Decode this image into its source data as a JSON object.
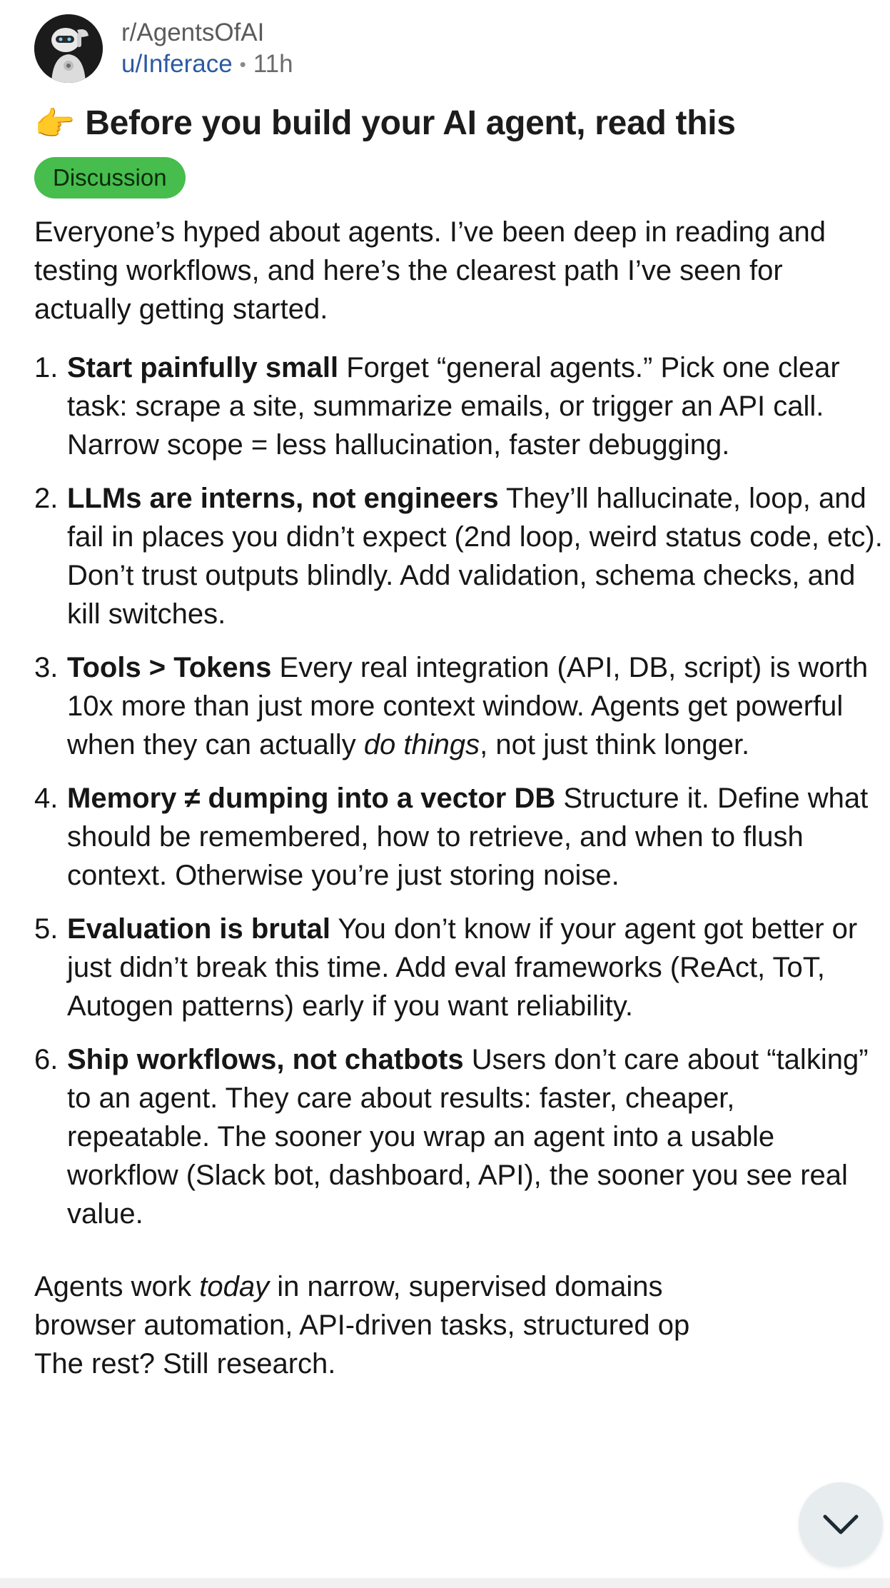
{
  "post": {
    "subreddit": "r/AgentsOfAI",
    "author": "u/Inferace",
    "separator": "•",
    "age": "11h",
    "title_emoji": "👉",
    "title": "Before you build your AI agent, read this",
    "flair": "Discussion",
    "intro": "Everyone’s hyped about agents. I’ve been deep in reading and testing workflows, and here’s the clearest path I’ve seen for actually getting started.",
    "points": [
      {
        "number": "1.",
        "heading": "Start painfully small",
        "text": " Forget “general agents.” Pick one clear task: scrape a site, summarize emails, or trigger an API call. Narrow scope = less hallucination, faster debugging."
      },
      {
        "number": "2.",
        "heading": "LLMs are interns, not engineers",
        "text": " They’ll hallucinate, loop, and fail in places you didn’t expect (2nd loop, weird status code, etc). Don’t trust outputs blindly. Add validation, schema checks, and kill switches."
      },
      {
        "number": "3.",
        "heading": "Tools > Tokens",
        "text_before": " Every real integration (API, DB, script) is worth 10x more than just more context window. Agents get powerful when they can actually ",
        "text_italic": "do things",
        "text_after": ", not just think longer."
      },
      {
        "number": "4.",
        "heading": "Memory ≠ dumping into a vector DB",
        "text": " Structure it. Define what should be remembered, how to retrieve, and when to flush context. Otherwise you’re just storing noise."
      },
      {
        "number": "5.",
        "heading": "Evaluation is brutal",
        "text": " You don’t know if your agent got better or just didn’t break this time. Add eval frameworks (ReAct, ToT, Autogen patterns) early if you want reliability."
      },
      {
        "number": "6.",
        "heading": "Ship workflows, not chatbots",
        "text": " Users don’t care about “talking” to an agent. They care about results: faster, cheaper, repeatable. The sooner you wrap an agent into a usable workflow (Slack bot, dashboard, API), the sooner you see real value."
      }
    ],
    "outro": {
      "line1_before": "Agents work ",
      "line1_italic": "today",
      "line1_after": " in narrow, supervised domains",
      "line2": "browser automation, API-driven tasks, structured op",
      "line3": "The rest? Still research."
    }
  },
  "icons": {
    "avatar": "robot-avatar-icon",
    "scroll": "chevron-down-icon"
  },
  "colors": {
    "flair_bg": "#46bd4d",
    "author": "#2c5aa0",
    "scroll_button_bg": "#e7ecef"
  }
}
